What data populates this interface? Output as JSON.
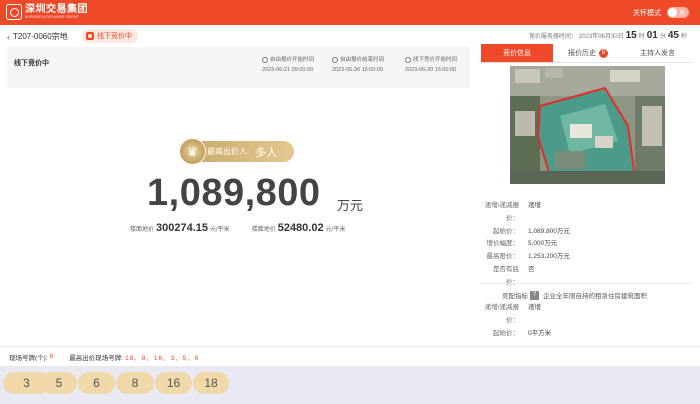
{
  "header": {
    "logo_cn": "深圳交易集团",
    "logo_en": "SHENZHEN EXCHANGE GROUP",
    "care_mode_label": "关怀模式",
    "toggle_text": "关"
  },
  "plot": {
    "title": "T207-0060宗地",
    "status": "线下竞价中"
  },
  "server_time": {
    "label": "竞价服务器时间：",
    "date": "2023年06月30日",
    "hour": "15",
    "hour_unit": "时",
    "minute": "01",
    "minute_unit": "分",
    "second": "45",
    "second_unit": "秒"
  },
  "schedule": {
    "title": "线下竞价中",
    "times": [
      {
        "label": "自由报价开始时间",
        "value": "2023-06-21 09:00:00"
      },
      {
        "label": "自由报价结束时间",
        "value": "2023-06-30 15:00:00"
      },
      {
        "label": "线下竞价开始时间",
        "value": "2023-06-30 15:00:00"
      }
    ]
  },
  "bid": {
    "top_bidder_label": "最高出价人:",
    "top_bidder_value": "多人",
    "price": "1,089,800",
    "price_unit": "万元",
    "floor_price_label": "楼面地价",
    "floor_price": "300274.15",
    "floor_price_unit": "元/平米",
    "land_price_label": "楼面地价",
    "land_price": "52480.02",
    "land_price_unit": "元/平米"
  },
  "tabs": [
    {
      "label": "竞价信息",
      "active": true
    },
    {
      "label": "报价历史",
      "badge": "6"
    },
    {
      "label": "主持人发言"
    }
  ],
  "params": [
    {
      "k": "递增/递减报价：",
      "v": "递增"
    },
    {
      "k": "起始价：",
      "v": "1,089,800万元"
    },
    {
      "k": "增价幅度：",
      "v": "5,000万元"
    },
    {
      "k": "最高限价：",
      "v": "1,253,200万元"
    },
    {
      "k": "是否有底价：",
      "v": "否"
    }
  ],
  "rules": {
    "indicator_label": "竞配指标",
    "indicator_badge": "?",
    "indicator_value": "企业全年限自持的租赁住房建筑面积",
    "rows": [
      {
        "k": "递增/递减报价：",
        "v": "递增"
      },
      {
        "k": "起始价：",
        "v": "0平方米"
      }
    ]
  },
  "bottom": {
    "count_label": "现场号牌(个):",
    "count_value": "6",
    "highest_label": "最高出价现场号牌:",
    "highest_value": "18、8、16、3、5、6"
  },
  "numbers": [
    "3",
    "5",
    "6",
    "8",
    "16",
    "18"
  ],
  "colors": {
    "accent": "#ee4a2a",
    "gold": "#c9a86a",
    "chip": "#f0d8a8"
  }
}
